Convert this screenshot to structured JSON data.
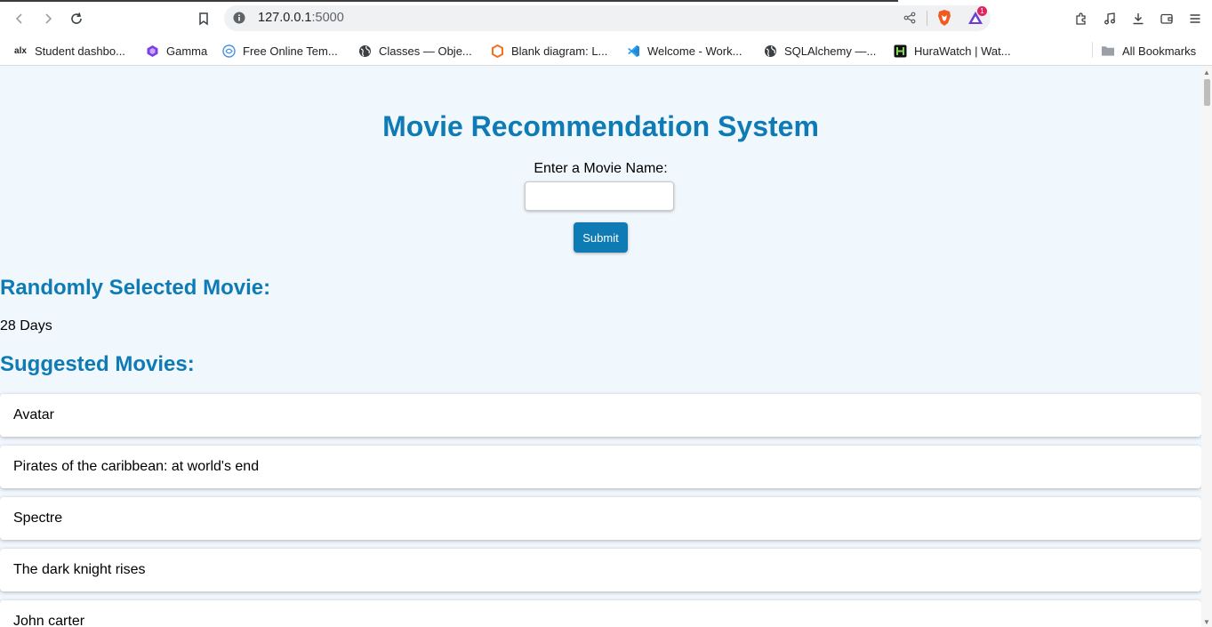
{
  "browser": {
    "url_host": "127.0.0.1",
    "url_port": ":5000",
    "notification_count": "1",
    "bookmarks": [
      {
        "label": "Student dashbo...",
        "icon": "alx-icon"
      },
      {
        "label": "Gamma",
        "icon": "gamma-icon"
      },
      {
        "label": "Free Online Tem...",
        "icon": "template-icon"
      },
      {
        "label": "Classes — Obje...",
        "icon": "globe-icon"
      },
      {
        "label": "Blank diagram: L...",
        "icon": "lucid-icon"
      },
      {
        "label": "Welcome - Work...",
        "icon": "vscode-icon"
      },
      {
        "label": "SQLAlchemy —...",
        "icon": "globe-icon"
      },
      {
        "label": "HuraWatch | Wat...",
        "icon": "hurawatch-icon"
      }
    ],
    "all_bookmarks": "All Bookmarks"
  },
  "page": {
    "title": "Movie Recommendation System",
    "input_label": "Enter a Movie Name:",
    "input_value": "",
    "submit_label": "Submit",
    "random_heading": "Randomly Selected Movie:",
    "random_movie": "28 Days",
    "suggested_heading": "Suggested Movies:",
    "suggestions": [
      "Avatar",
      "Pirates of the caribbean: at world's end",
      "Spectre",
      "The dark knight rises",
      "John carter"
    ]
  },
  "colors": {
    "accent": "#0f7bb5",
    "page_bg": "#f0f7fd"
  }
}
